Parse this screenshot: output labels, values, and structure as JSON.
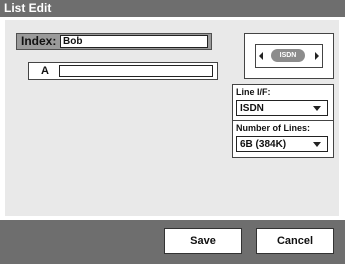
{
  "window": {
    "title": "List Edit"
  },
  "index": {
    "label": "Index:",
    "value": "Bob"
  },
  "entry": {
    "label": "A",
    "value": ""
  },
  "selector": {
    "value": "ISDN",
    "prev_icon": "caret-left-icon",
    "next_icon": "caret-right-icon"
  },
  "line_if": {
    "label": "Line I/F:",
    "value": "ISDN"
  },
  "number_of_lines": {
    "label": "Number of Lines:",
    "value": "6B (384K)"
  },
  "buttons": {
    "save": "Save",
    "cancel": "Cancel"
  }
}
